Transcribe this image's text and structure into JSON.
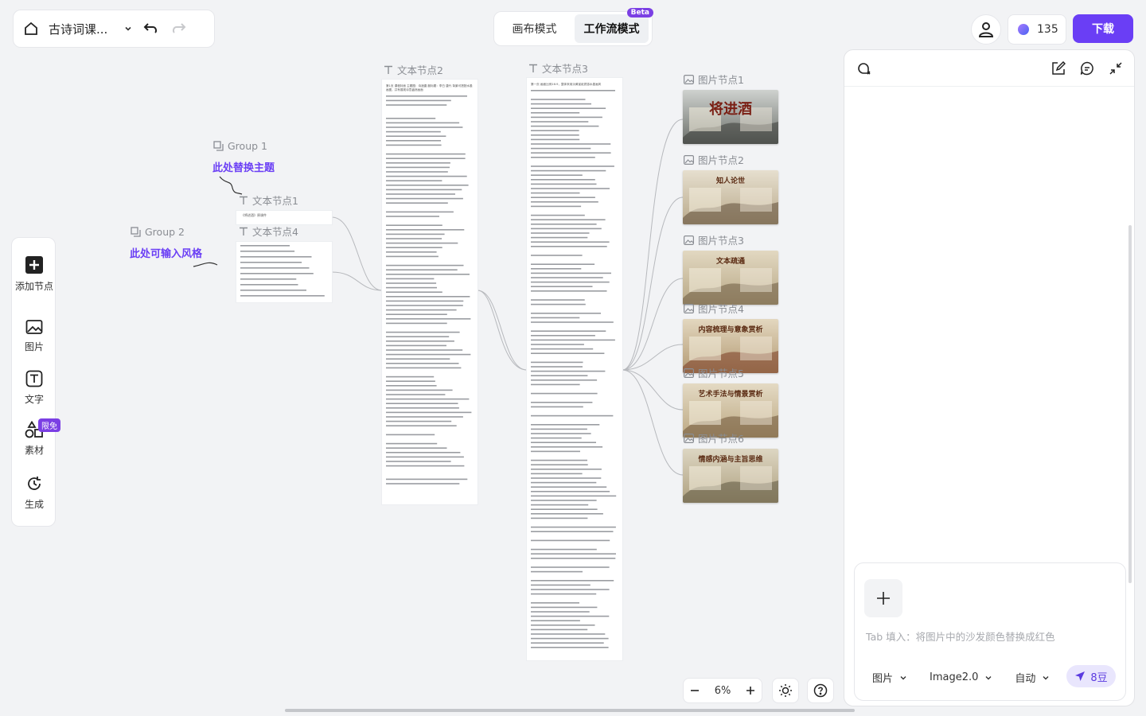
{
  "topbar": {
    "doc_title": "古诗词课...",
    "modes": [
      "画布模式",
      "工作流模式"
    ],
    "active_mode": "工作流模式",
    "beta_badge": "Beta",
    "credits": "135",
    "download_label": "下载"
  },
  "left_toolbar": {
    "items": [
      {
        "label": "添加节点",
        "icon": "add-node-icon"
      },
      {
        "label": "图片",
        "icon": "image-icon"
      },
      {
        "label": "文字",
        "icon": "text-icon"
      },
      {
        "label": "素材",
        "icon": "shapes-icon"
      },
      {
        "label": "生成",
        "icon": "generate-icon"
      }
    ],
    "limited_badge": "限免"
  },
  "canvas": {
    "groups": [
      {
        "label": "Group 1",
        "title": "此处替换主题"
      },
      {
        "label": "Group 2",
        "title": "此处可输入风格"
      }
    ],
    "text_nodes": [
      {
        "label": "文本节点1",
        "content": "《将进酒》原课件"
      },
      {
        "label": "文本节点4"
      },
      {
        "label": "文本节点2",
        "content": "第1页 课程封面 主题图：诗酒唐 副标题：李白 唐代 背景可搭配水墨画图，并有展现诗意盎然画面"
      },
      {
        "label": "文本节点3",
        "content": "第一页 画面比例16:9，整体采用淡黄宣纸质感水墨画风"
      }
    ],
    "image_nodes": [
      {
        "label": "图片节点1",
        "title": "将进酒"
      },
      {
        "label": "图片节点2",
        "title": "知人论世"
      },
      {
        "label": "图片节点3",
        "title": "文本疏通"
      },
      {
        "label": "图片节点4",
        "title": "内容梳理与意象赏析"
      },
      {
        "label": "图片节点5",
        "title": "艺术手法与情景赏析"
      },
      {
        "label": "图片节点6",
        "title": "情感内涵与主旨思维"
      }
    ],
    "zoom": "6%"
  },
  "right_panel": {
    "prompt_placeholder": "Tab 填入：将图片中的沙发颜色替换成红色",
    "options": [
      "图片",
      "Image2.0",
      "自动"
    ],
    "send_cost": "8豆"
  },
  "colors": {
    "accent": "#6a3ef5",
    "group_title": "#6a3ef5",
    "badge": "#7b3fe4"
  }
}
